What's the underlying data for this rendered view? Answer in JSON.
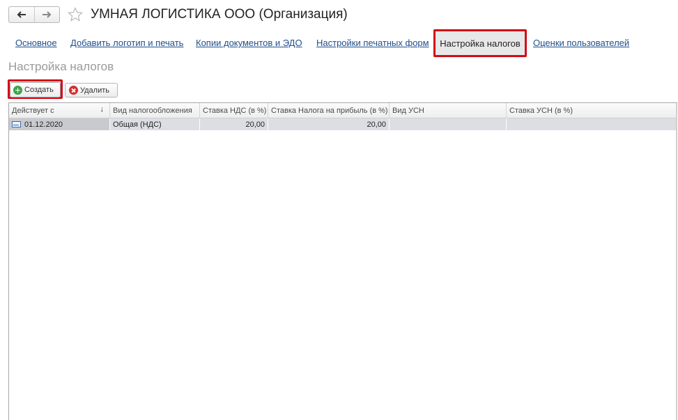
{
  "header": {
    "back_icon": "arrow-left-icon",
    "forward_icon": "arrow-right-icon",
    "favorite_icon": "star-outline-icon",
    "title": "УМНАЯ ЛОГИСТИКА ООО (Организация)"
  },
  "tabs": [
    {
      "label": "Основное",
      "active": false
    },
    {
      "label": "Добавить логотип и печать",
      "active": false
    },
    {
      "label": "Копии документов и ЭДО",
      "active": false
    },
    {
      "label": "Настройки печатных форм",
      "active": false
    },
    {
      "label": "Настройка налогов",
      "active": true
    },
    {
      "label": "Оценки пользователей",
      "active": false
    }
  ],
  "section_title": "Настройка налогов",
  "toolbar": {
    "create_label": "Создать",
    "delete_label": "Удалить"
  },
  "table": {
    "columns": [
      "Действует с",
      "Вид налогообложения",
      "Ставка НДС (в %)",
      "Ставка Налога на прибыль (в %)",
      "Вид УСН",
      "Ставка УСН (в %)"
    ],
    "rows": [
      [
        "01.12.2020",
        "Общая (НДС)",
        "20,00",
        "20,00",
        "",
        ""
      ]
    ]
  },
  "colors": {
    "highlight": "#d10b18",
    "link": "#1f4e8c",
    "selected_row": "#dcdee3"
  }
}
